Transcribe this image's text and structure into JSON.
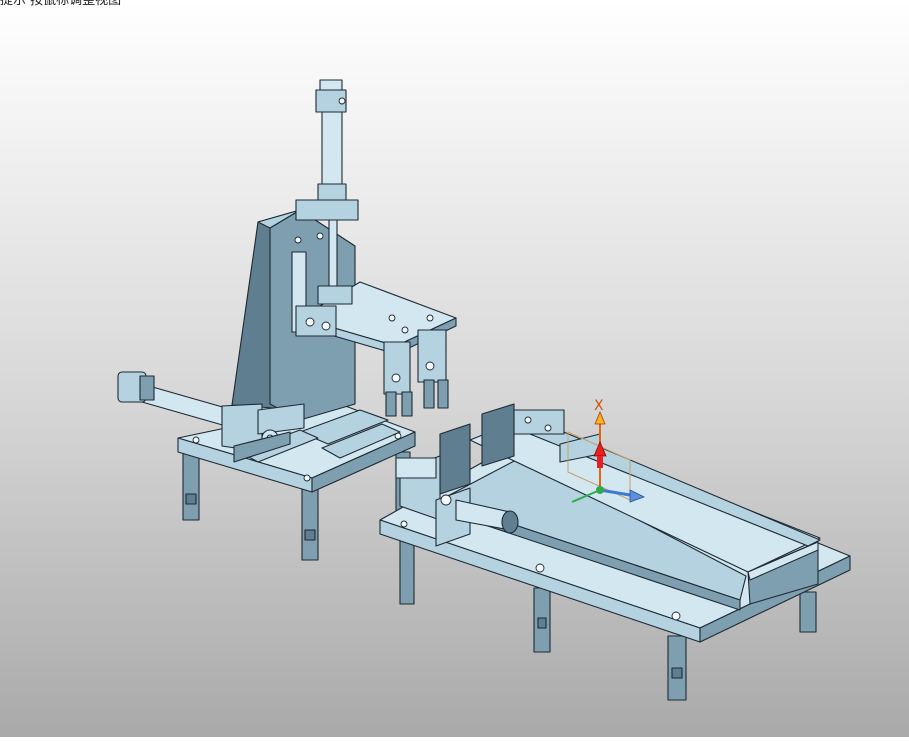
{
  "viewport": {
    "hint_text": "提示 按鼠标调整视图",
    "triad": {
      "x_label": "X",
      "colors": {
        "x_axis": "#e8620c",
        "y_axis": "#3a7bd5",
        "z_axis": "#2fa84f",
        "origin": "#d61c1c"
      }
    }
  },
  "model": {
    "parts": [
      "press-frame",
      "vertical-cylinder",
      "gripper-plate",
      "horizontal-cylinder",
      "base-table-left",
      "conveyor-table-right",
      "push-cylinder"
    ]
  }
}
